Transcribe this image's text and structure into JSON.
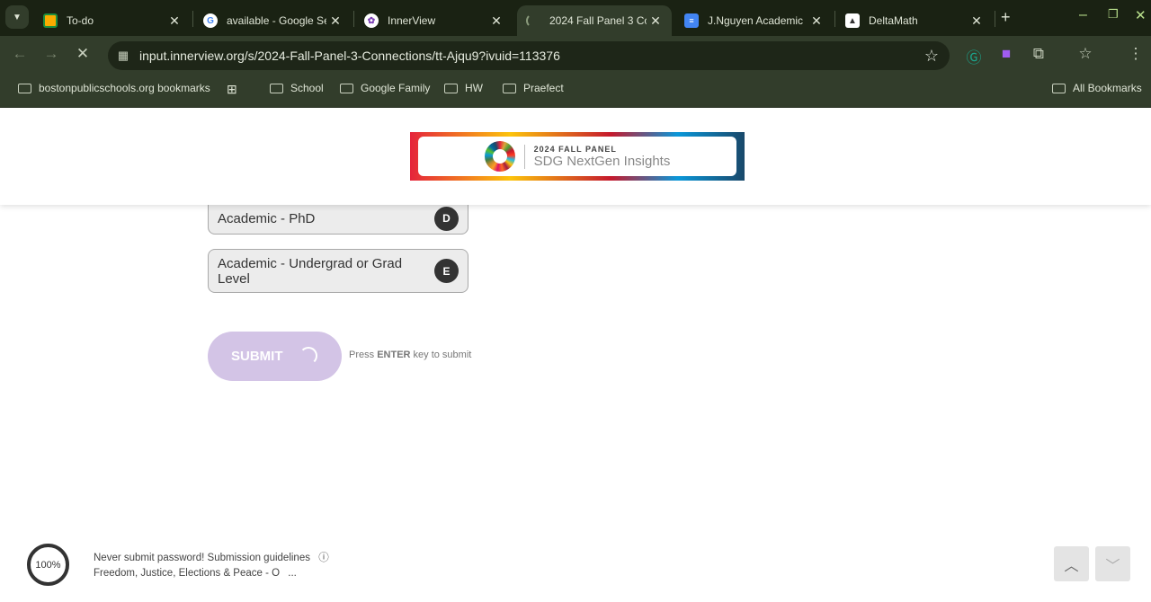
{
  "browser": {
    "tabs": [
      {
        "title": "To-do",
        "icon": "google-classroom-icon",
        "color": "#f9ab00"
      },
      {
        "title": "available - Google Se",
        "icon": "google-icon",
        "color": "#ffffff"
      },
      {
        "title": "InnerView",
        "icon": "innerview-icon",
        "color": "#ffffff"
      },
      {
        "title": "2024 Fall Panel 3 Co",
        "icon": "loading-spinner-icon",
        "color": "#323d2b"
      },
      {
        "title": "J.Nguyen Academic",
        "icon": "google-docs-icon",
        "color": "#4285f4"
      },
      {
        "title": "DeltaMath",
        "icon": "deltamath-icon",
        "color": "#ffffff"
      }
    ],
    "url": "input.innerview.org/s/2024-Fall-Panel-3-Connections/tt-Ajqu9?ivuid=113376",
    "bookmarks": [
      "bostonpublicschools.org bookmarks",
      "School",
      "Google Family",
      "HW",
      "Praefect"
    ],
    "all_bookmarks": "All Bookmarks"
  },
  "logo": {
    "line1": "2024 FALL PANEL",
    "line2": "SDG NextGen Insights"
  },
  "options": [
    {
      "label": "Academic - PhD",
      "key": "D"
    },
    {
      "label": "Academic - Undergrad or Grad Level",
      "key": "E"
    }
  ],
  "submit": {
    "label": "SUBMIT",
    "hint_pre": "Press",
    "hint_key": "ENTER",
    "hint_post": "key to submit"
  },
  "footer": {
    "progress": "100%",
    "guidelines": "Never submit password! Submission guidelines",
    "section": "Freedom, Justice, Elections & Peace - O",
    "ellipsis": "..."
  }
}
